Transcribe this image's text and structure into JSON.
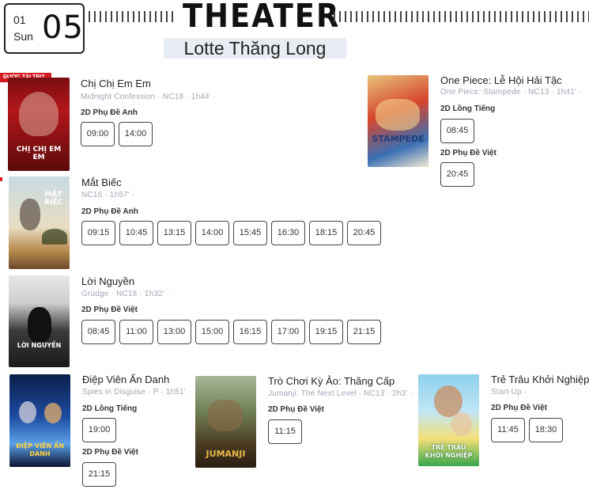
{
  "header": {
    "month": "01",
    "weekday": "Sun",
    "day": "05",
    "title": "THEATER",
    "cinema": "Lotte Thăng Long"
  },
  "sponsor_label": "ĐƯỢC TÀI TRỢ",
  "movies": [
    {
      "title": "Chị Chị Em Em",
      "subtitle": "Midnight Confession · NC18 · 1h44' ·",
      "poster_text": "CHỊ CHỊ EM EM",
      "formats": [
        {
          "label": "2D Phụ Đề Anh",
          "times": [
            "09:00",
            "14:00"
          ]
        }
      ]
    },
    {
      "title": "One Piece: Lễ Hội Hải Tặc",
      "subtitle": "One Piece: Stampede · NC13 · 1h41' ·",
      "poster_text": "STAMPEDE",
      "formats": [
        {
          "label": "2D Lồng Tiếng",
          "times": [
            "08:45"
          ]
        },
        {
          "label": "2D Phụ Đề Việt",
          "times": [
            "20:45"
          ]
        }
      ]
    },
    {
      "title": "Mắt Biếc",
      "subtitle": "NC16 · 1h57' ·",
      "poster_text": "MẮT BIẾC",
      "formats": [
        {
          "label": "2D Phụ Đề Anh",
          "times": [
            "09:15",
            "10:45",
            "13:15",
            "14:00",
            "15:45",
            "16:30",
            "18:15",
            "20:45"
          ]
        }
      ]
    },
    {
      "title": "Lời Nguyền",
      "subtitle": "Grudge · NC18 · 1h32' ·",
      "poster_text": "LỜI NGUYỀN",
      "formats": [
        {
          "label": "2D Phụ Đề Việt",
          "times": [
            "08:45",
            "11:00",
            "13:00",
            "15:00",
            "16:15",
            "17:00",
            "19:15",
            "21:15"
          ]
        }
      ]
    },
    {
      "title": "Điệp Viên Ẩn Danh",
      "subtitle": "Spies in Disguise · P · 1h51' ·",
      "poster_text": "ĐIỆP VIÊN ẨN DANH",
      "formats": [
        {
          "label": "2D Lồng Tiếng",
          "times": [
            "19:00"
          ]
        },
        {
          "label": "2D Phụ Đề Việt",
          "times": [
            "21:15"
          ]
        }
      ]
    },
    {
      "title": "Trò Chơi Kỳ Ảo: Thăng Cấp",
      "subtitle": "Jumanji: The Next Level · NC13 · 2h3' ·",
      "poster_text": "JUMANJI",
      "formats": [
        {
          "label": "2D Phụ Đề Việt",
          "times": [
            "11:15"
          ]
        }
      ]
    },
    {
      "title": "Trẻ Trâu Khởi Nghiệp",
      "subtitle": "Start-Up ·",
      "poster_text": "TRẺ TRÂU KHỞI NGHIỆP",
      "formats": [
        {
          "label": "2D Phụ Đề Việt",
          "times": [
            "11:45",
            "18:30"
          ]
        }
      ]
    }
  ],
  "colors": {
    "sponsor_red": "#d51920",
    "cinema_bg": "#e8edf4",
    "subtitle_gray": "#a0a6b4"
  }
}
